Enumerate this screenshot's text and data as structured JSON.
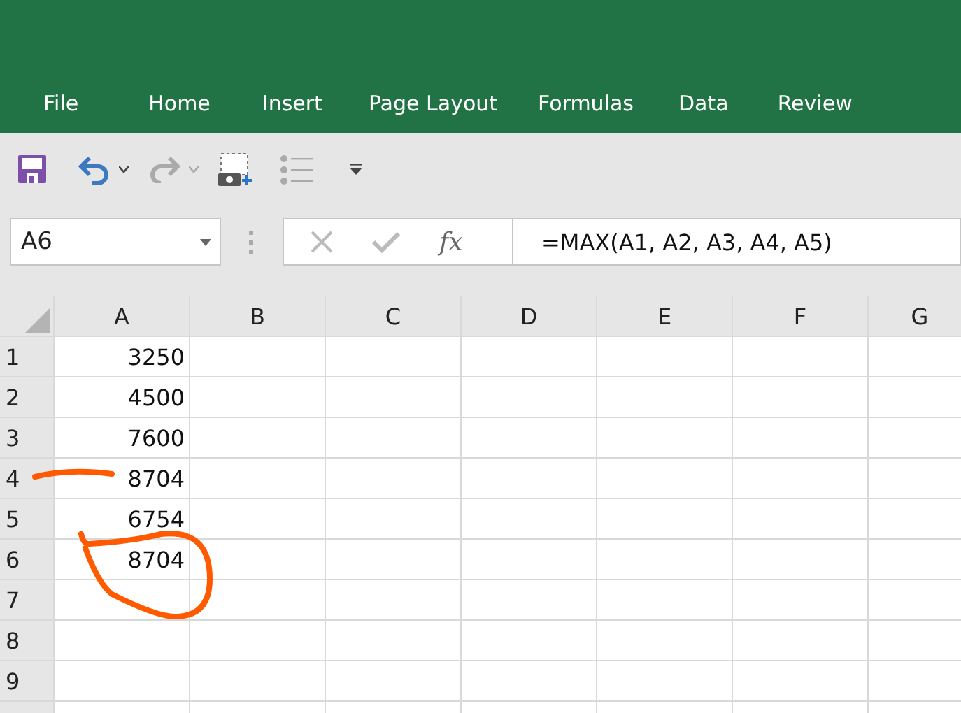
{
  "ribbon_tabs": [
    "File",
    "Home",
    "Insert",
    "Page Layout",
    "Formulas",
    "Data",
    "Review"
  ],
  "name_box": {
    "value": "A6"
  },
  "formula_bar": {
    "fx_label": "fx",
    "value": "=MAX(A1, A2, A3, A4, A5)"
  },
  "columns": [
    "A",
    "B",
    "C",
    "D",
    "E",
    "F",
    "G"
  ],
  "rows": [
    {
      "number": "1",
      "cells": [
        "3250"
      ]
    },
    {
      "number": "2",
      "cells": [
        "4500"
      ]
    },
    {
      "number": "3",
      "cells": [
        "7600"
      ]
    },
    {
      "number": "4",
      "cells": [
        "8704"
      ]
    },
    {
      "number": "5",
      "cells": [
        "6754"
      ]
    },
    {
      "number": "6",
      "cells": [
        "8704"
      ]
    },
    {
      "number": "7",
      "cells": []
    },
    {
      "number": "8",
      "cells": []
    },
    {
      "number": "9",
      "cells": []
    }
  ]
}
